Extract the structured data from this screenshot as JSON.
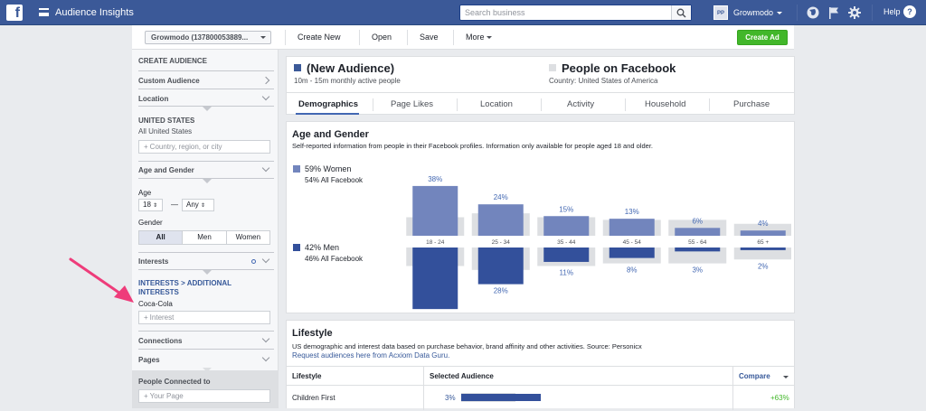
{
  "topbar": {
    "logo": "f",
    "app_title": "Audience Insights",
    "search_placeholder": "Search business",
    "account_initials": "PP",
    "account_name": "Growmodo",
    "help": "Help",
    "help_icon": "?",
    "bg_color": "#3b5998"
  },
  "toolbar": {
    "audience_select": "Growmodo (137800053889...",
    "create_new": "Create New",
    "open": "Open",
    "save": "Save",
    "more": "More",
    "create_ad": "Create Ad"
  },
  "sidebar": {
    "create_audience": "CREATE AUDIENCE",
    "custom_audience": "Custom Audience",
    "location": "Location",
    "country": "UNITED STATES",
    "country_sub": "All United States",
    "country_placeholder": "Country, region, or city",
    "age_gender": "Age and Gender",
    "age_label": "Age",
    "age_min": "18",
    "age_dash": "—",
    "age_max": "Any",
    "gender_label": "Gender",
    "gender_options": [
      "All",
      "Men",
      "Women"
    ],
    "gender_selected": "All",
    "interests": "Interests",
    "interests_path": "INTERESTS > ADDITIONAL INTERESTS",
    "interest_value": "Coca-Cola",
    "interest_placeholder": "Interest",
    "connections": "Connections",
    "pages": "Pages",
    "people_connected": "People Connected to",
    "page_placeholder": "Your Page",
    "plus": "+"
  },
  "header": {
    "audience_title": "(New Audience)",
    "audience_sub": "10m - 15m monthly active people",
    "compare_title": "People on Facebook",
    "compare_sub": "Country: United States of America",
    "audience_color": "#3b5998",
    "compare_color": "#dddfe2"
  },
  "tabs": [
    "Demographics",
    "Page Likes",
    "Location",
    "Activity",
    "Household",
    "Purchase"
  ],
  "age_gender": {
    "title": "Age and Gender",
    "description": "Self-reported information from people in their Facebook profiles. Information only available for people aged 18 and older.",
    "women_label": "59% Women",
    "women_sub": "54% All Facebook",
    "men_label": "42% Men",
    "men_sub": "46% All Facebook"
  },
  "chart_data": {
    "type": "bar",
    "categories": [
      "18 - 24",
      "25 - 34",
      "35 - 44",
      "45 - 54",
      "55 - 64",
      "65 +"
    ],
    "series": [
      {
        "name": "Women",
        "values": [
          38,
          24,
          15,
          13,
          6,
          4
        ],
        "color": "#7285bd"
      },
      {
        "name": "Men",
        "values": [
          47,
          28,
          11,
          8,
          3,
          2
        ],
        "color": "#33509b"
      }
    ],
    "baseline_color": "#dddfe2",
    "baseline_women": [
      10,
      13,
      10,
      8,
      8,
      5
    ],
    "baseline_men": [
      10,
      13,
      10,
      8,
      8,
      5
    ],
    "ylim": [
      0,
      50
    ]
  },
  "lifestyle": {
    "title": "Lifestyle",
    "description": "US demographic and interest data based on purchase behavior, brand affinity and other activities. Source: Personicx",
    "link": "Request audiences here from Acxiom Data Guru.",
    "col_lifestyle": "Lifestyle",
    "col_selected": "Selected Audience",
    "col_compare": "Compare",
    "rows": [
      {
        "name": "Children First",
        "pct": "3%",
        "bar_fraction": 0.03,
        "compare": "+63%"
      }
    ]
  }
}
